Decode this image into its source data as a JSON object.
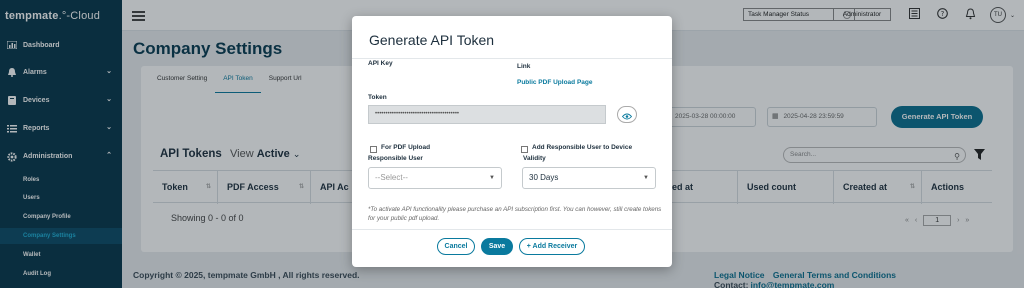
{
  "app": {
    "brand_bold": "tempmate",
    "brand_rest": ".°-Cloud"
  },
  "sidebar": {
    "items": [
      {
        "label": "Dashboard",
        "icon": "dashboard-icon"
      },
      {
        "label": "Alarms",
        "icon": "bell-icon"
      },
      {
        "label": "Devices",
        "icon": "device-icon"
      },
      {
        "label": "Reports",
        "icon": "list-icon"
      },
      {
        "label": "Administration",
        "icon": "gear-icon"
      }
    ],
    "sub_items": [
      {
        "label": "Roles"
      },
      {
        "label": "Users"
      },
      {
        "label": "Company Profile"
      },
      {
        "label": "Company Settings",
        "active": true
      },
      {
        "label": "Wallet"
      },
      {
        "label": "Audit Log"
      }
    ]
  },
  "topbar": {
    "task_manager": "Task Manager Status",
    "admin": "Administrator",
    "avatar": "TU"
  },
  "page": {
    "title": "Company Settings",
    "tabs": [
      "Customer Setting",
      "API Token",
      "Support Url"
    ],
    "active_tab": "API Token",
    "date_from": "2025-03-28 00:00:00",
    "date_to": "2025-04-28 23:59:59",
    "generate_button": "Generate API Token",
    "section_title": "API Tokens",
    "view_prefix": "View",
    "view_value": "Active",
    "search_placeholder": "Search...",
    "columns": [
      "Token",
      "PDF Access",
      "API Ac",
      "sed at",
      "Used count",
      "Created at",
      "Actions"
    ],
    "showing": "Showing 0 - 0 of 0",
    "page_number": "1"
  },
  "footer": {
    "copyright": "Copyright © 2025, tempmate GmbH , All rights reserved.",
    "legal": "Legal Notice",
    "terms": "General Terms and Conditions",
    "contact_prefix": "Contact:",
    "contact_email": "info@tempmate.com"
  },
  "modal": {
    "title": "Generate API Token",
    "api_key_label": "API Key",
    "link_label": "Link",
    "link_value": "Public PDF Upload Page",
    "token_label": "Token",
    "token_value": "••••••••••••••••••••••••••••••••••••••••",
    "pdf_upload_label": "For PDF Upload",
    "responsible_user_label": "Responsible User",
    "responsible_user_placeholder": "--Select--",
    "add_responsible_label": "Add Responsible User to Device",
    "validity_label": "Validity",
    "validity_value": "30 Days",
    "note": "*To activate API functionality please purchase an API subscription first. You can however, still create tokens for your public pdf upload.",
    "cancel": "Cancel",
    "save": "Save",
    "add_receiver": "+ Add Receiver"
  },
  "colors": {
    "sidebar": "#07364a",
    "accent": "#0a7a9e",
    "primary_button": "#0a6f8f"
  }
}
